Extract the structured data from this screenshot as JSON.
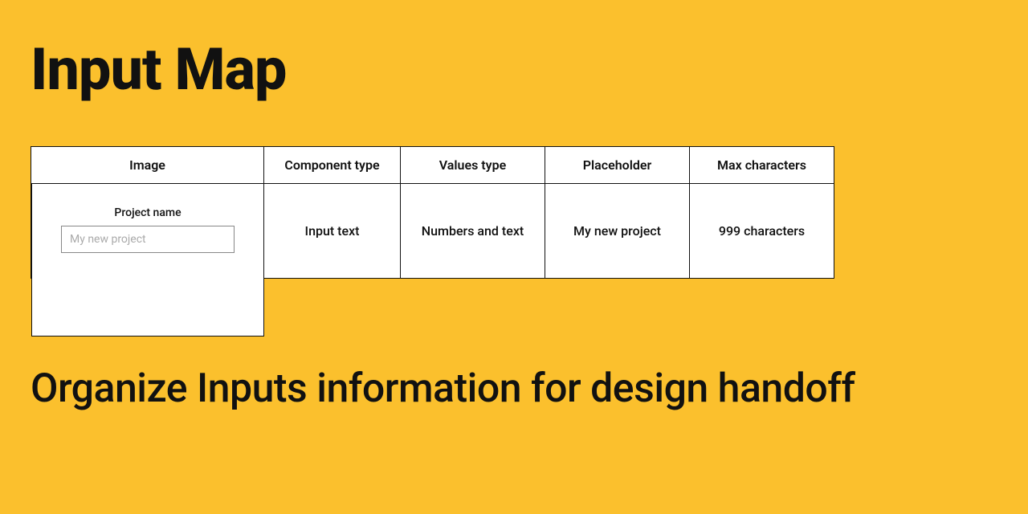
{
  "title": "Input Map",
  "table": {
    "headers": {
      "image": "Image",
      "component_type": "Component type",
      "values_type": "Values type",
      "placeholder": "Placeholder",
      "max_chars": "Max characters"
    },
    "row": {
      "preview": {
        "label": "Project name",
        "placeholder": "My new project"
      },
      "component_type": "Input text",
      "values_type": "Numbers and text",
      "placeholder": "My new project",
      "max_chars": "999 characters"
    }
  },
  "subtitle": "Organize Inputs information for design handoff"
}
